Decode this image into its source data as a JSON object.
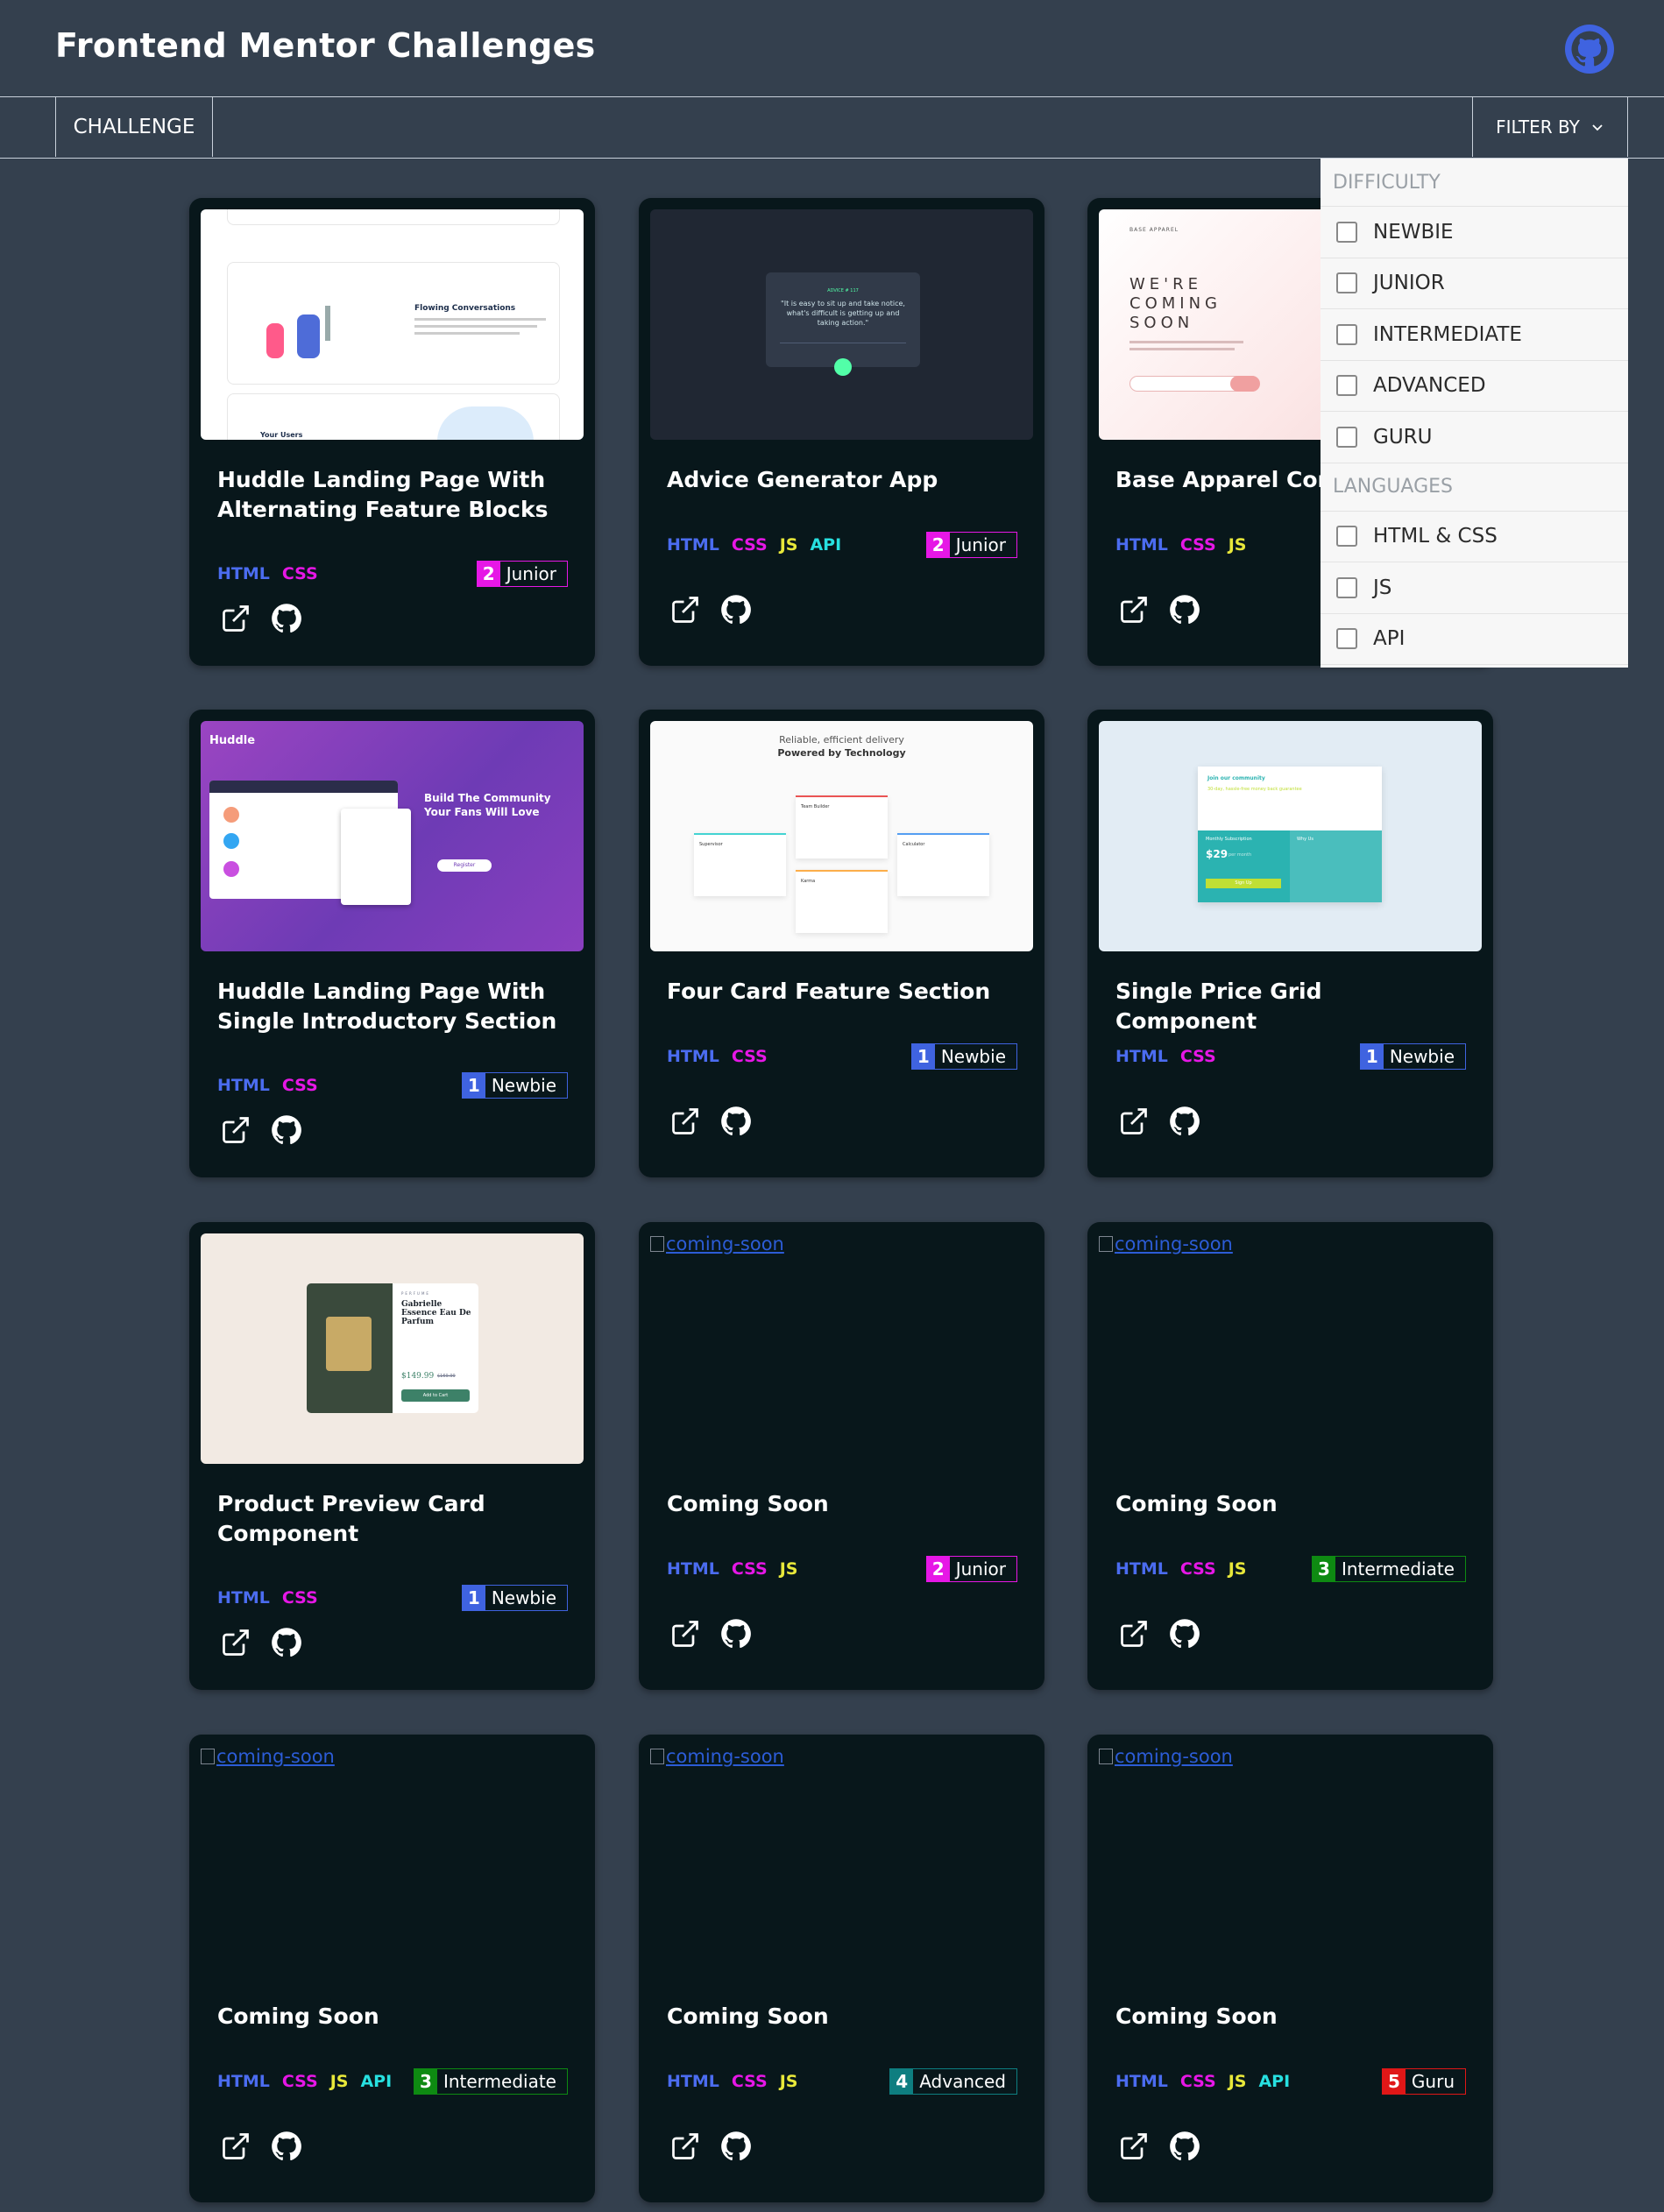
{
  "header": {
    "title": "Frontend Mentor Challenges",
    "github_icon": "github-icon"
  },
  "nav": {
    "challenge_label": "CHALLENGE",
    "filter_label": "FILTER BY"
  },
  "filter": {
    "difficulty_heading": "DIFFICULTY",
    "difficulty": [
      "NEWBIE",
      "JUNIOR",
      "INTERMEDIATE",
      "ADVANCED",
      "GURU"
    ],
    "languages_heading": "LANGUAGES",
    "languages": [
      "HTML & CSS",
      "JS",
      "API"
    ]
  },
  "colors": {
    "background": "#34404e",
    "card": "#08171b",
    "html": "#4b6cf0",
    "css": "#e617e6",
    "js": "#e8e83a",
    "api": "#27e0e0"
  },
  "cards": [
    {
      "title": "Huddle Landing Page With Alternating Feature Blocks",
      "techs": [
        "HTML",
        "CSS"
      ],
      "level_num": "2",
      "level": "Junior",
      "thumb": "huddle-alt"
    },
    {
      "title": "Advice Generator App",
      "techs": [
        "HTML",
        "CSS",
        "JS",
        "API"
      ],
      "level_num": "2",
      "level": "Junior",
      "thumb": "advice"
    },
    {
      "title": "Base Apparel Coming Soon Page",
      "techs": [
        "HTML",
        "CSS",
        "JS"
      ],
      "level_num": "",
      "level": "",
      "thumb": "base"
    },
    {
      "title": "Huddle Landing Page With Single Introductory Section",
      "techs": [
        "HTML",
        "CSS"
      ],
      "level_num": "1",
      "level": "Newbie",
      "thumb": "huddle-single"
    },
    {
      "title": "Four Card Feature Section",
      "techs": [
        "HTML",
        "CSS"
      ],
      "level_num": "1",
      "level": "Newbie",
      "thumb": "four-card"
    },
    {
      "title": "Single Price Grid Component",
      "techs": [
        "HTML",
        "CSS"
      ],
      "level_num": "1",
      "level": "Newbie",
      "thumb": "price-grid"
    },
    {
      "title": "Product Preview Card Component",
      "techs": [
        "HTML",
        "CSS"
      ],
      "level_num": "1",
      "level": "Newbie",
      "thumb": "product"
    },
    {
      "title": "Coming Soon",
      "techs": [
        "HTML",
        "CSS",
        "JS"
      ],
      "level_num": "2",
      "level": "Junior",
      "thumb": "coming-soon"
    },
    {
      "title": "Coming Soon",
      "techs": [
        "HTML",
        "CSS",
        "JS"
      ],
      "level_num": "3",
      "level": "Intermediate",
      "thumb": "coming-soon"
    },
    {
      "title": "Coming Soon",
      "techs": [
        "HTML",
        "CSS",
        "JS",
        "API"
      ],
      "level_num": "3",
      "level": "Intermediate",
      "thumb": "coming-soon"
    },
    {
      "title": "Coming Soon",
      "techs": [
        "HTML",
        "CSS",
        "JS"
      ],
      "level_num": "4",
      "level": "Advanced",
      "thumb": "coming-soon"
    },
    {
      "title": "Coming Soon",
      "techs": [
        "HTML",
        "CSS",
        "JS",
        "API"
      ],
      "level_num": "5",
      "level": "Guru",
      "thumb": "coming-soon"
    }
  ],
  "coming_soon_alt": "coming-soon",
  "thumb_text": {
    "huddle_alt_heading": "Flowing Conversations",
    "huddle_alt_heading2": "Your Users",
    "advice_label": "ADVICE # 117",
    "advice_quote": "\"It is easy to sit up and take notice, what's difficult is getting up and taking action.\"",
    "base_logo": "BASE APPAREL",
    "base_heading": "WE'RE COMING SOON",
    "huddle_single_logo": "Huddle",
    "huddle_single_heading": "Build The Community Your Fans Will Love",
    "huddle_single_button": "Register",
    "four_card_heading1": "Reliable, efficient delivery",
    "four_card_heading2": "Powered by Technology",
    "four_card_cards": [
      "Supervisor",
      "Team Builder",
      "Karma",
      "Calculator"
    ],
    "price_heading": "Join our community",
    "price_sub": "30-day, hassle-free money back guarantee",
    "price_monthly": "Monthly Subscription",
    "price_amount": "$29",
    "price_per": "per month",
    "price_why": "Why Us",
    "price_button": "Sign Up",
    "product_category": "PERFUME",
    "product_name": "Gabrielle Essence Eau De Parfum",
    "product_price": "$149.99",
    "product_old_price": "$169.99",
    "product_button": "Add to Cart"
  }
}
